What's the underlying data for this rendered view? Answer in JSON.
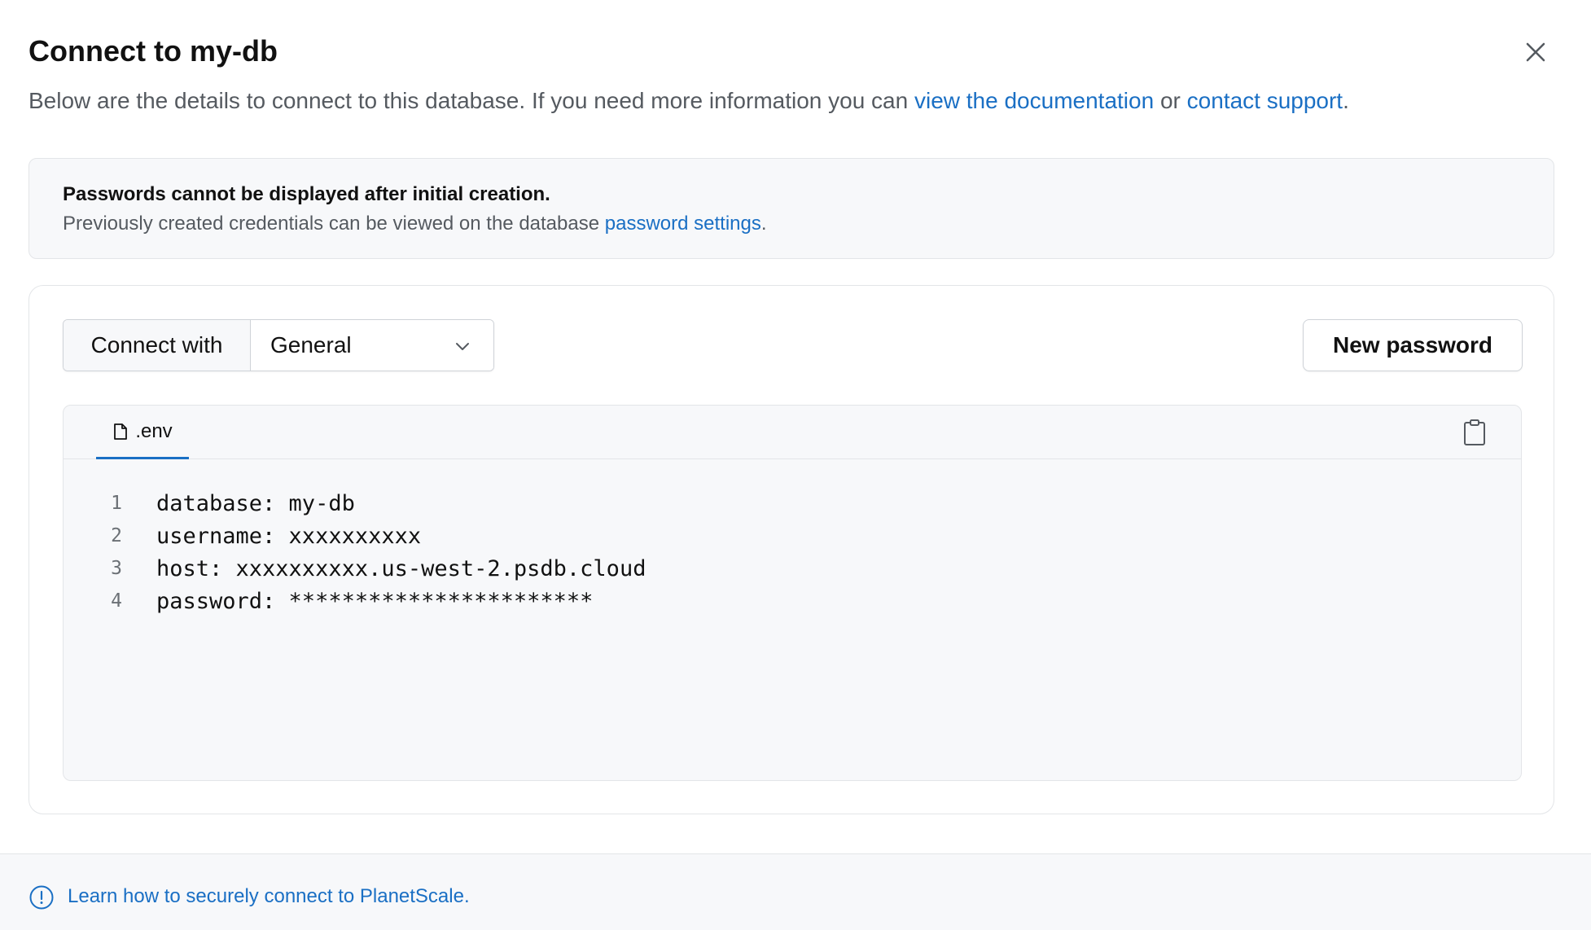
{
  "modal": {
    "title": "Connect to my-db",
    "close_icon": "close-icon",
    "subtitle": {
      "prefix": "Below are the details to connect to this database. If you need more information you can ",
      "docs_link": "view the documentation",
      "middle": " or ",
      "support_link": "contact support",
      "suffix": "."
    }
  },
  "notice": {
    "title": "Passwords cannot be displayed after initial creation.",
    "text_prefix": "Previously created credentials can be viewed on the database ",
    "link": "password settings",
    "text_suffix": "."
  },
  "connect": {
    "label": "Connect with",
    "selected": "General",
    "chevron_icon": "chevron-down-icon",
    "new_password_label": "New password"
  },
  "code": {
    "tab_label": ".env",
    "tab_icon": "file-icon",
    "copy_icon": "clipboard-icon",
    "lines": [
      {
        "n": "1",
        "text": "database: my-db"
      },
      {
        "n": "2",
        "text": "username: xxxxxxxxxx"
      },
      {
        "n": "3",
        "text": "host: xxxxxxxxxx.us-west-2.psdb.cloud"
      },
      {
        "n": "4",
        "text": "password: ***********************"
      }
    ]
  },
  "footer": {
    "icon": "info-icon",
    "link": "Learn how to securely connect to PlanetScale."
  },
  "colors": {
    "link": "#1a6fc4",
    "muted_text": "#555a60",
    "panel_bg": "#f7f8fa",
    "border": "#e3e5e8"
  }
}
